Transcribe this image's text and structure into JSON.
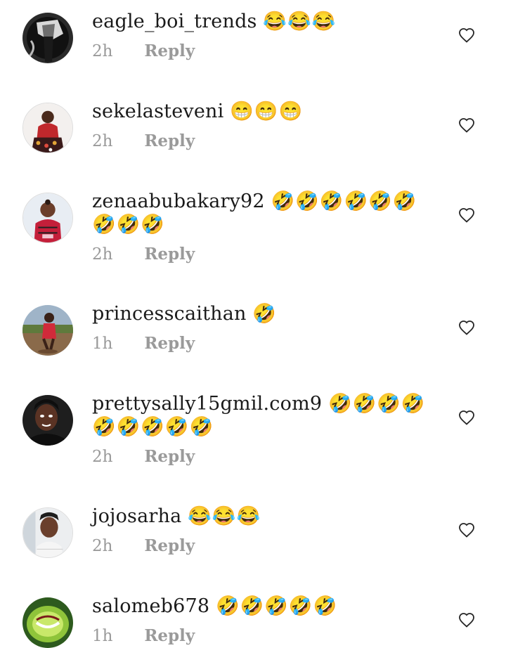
{
  "comments": [
    {
      "username": "eagle_boi_trends",
      "text": "😂😂😂",
      "time": "2h",
      "reply": "Reply",
      "avatar": "avatar-bw-hand"
    },
    {
      "username": "sekelasteveni",
      "text": "😁😁😁",
      "time": "2h",
      "reply": "Reply",
      "avatar": "avatar-woman-red-dress"
    },
    {
      "username": "zenaabubakary92",
      "text": "🤣🤣🤣🤣🤣🤣🤣🤣🤣",
      "time": "2h",
      "reply": "Reply",
      "avatar": "avatar-child-red"
    },
    {
      "username": "princesscaithan",
      "text": "🤣",
      "time": "1h",
      "reply": "Reply",
      "avatar": "avatar-child-outdoor"
    },
    {
      "username": "prettysally15gmil.com9",
      "text": "🤣🤣🤣🤣🤣🤣🤣🤣🤣",
      "time": "2h",
      "reply": "Reply",
      "avatar": "avatar-woman-dark"
    },
    {
      "username": "jojosarha",
      "text": "😂😂😂",
      "time": "2h",
      "reply": "Reply",
      "avatar": "avatar-woman-light"
    },
    {
      "username": "salomeb678",
      "text": "🤣🤣🤣🤣🤣",
      "time": "1h",
      "reply": "Reply",
      "avatar": "avatar-lime-mouth"
    }
  ],
  "colors": {
    "text": "#1a1a1a",
    "meta": "#9a9a9a",
    "heart_outline": "#262626"
  },
  "icons": {
    "like": "heart-outline-icon"
  }
}
